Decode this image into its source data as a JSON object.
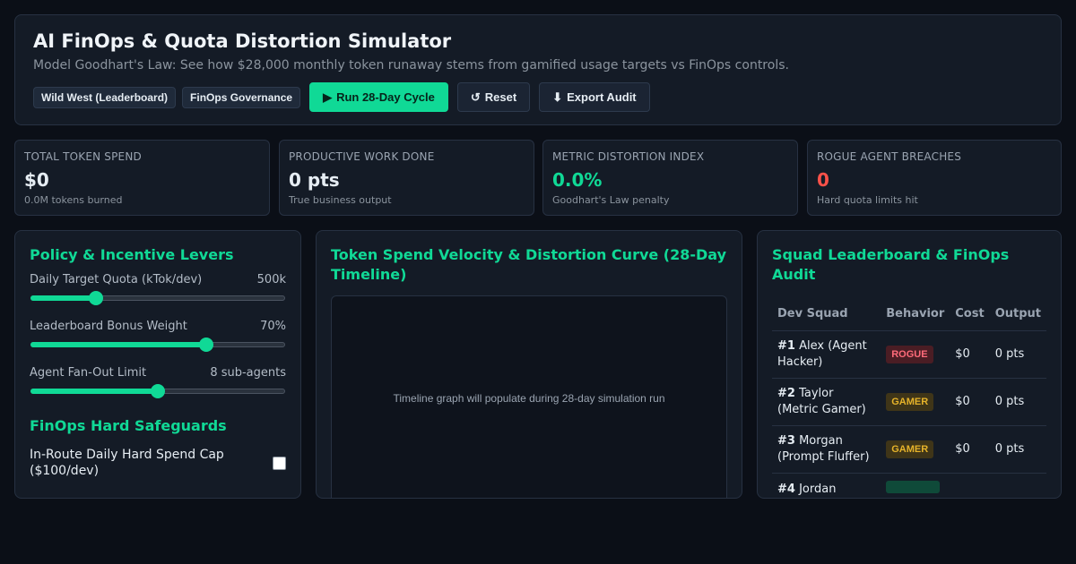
{
  "header": {
    "title": "AI FinOps & Quota Distortion Simulator",
    "subtitle": "Model Goodhart's Law: See how $28,000 monthly token runaway stems from gamified usage targets vs FinOps controls.",
    "modes": [
      "Wild West (Leaderboard)",
      "FinOps Governance"
    ],
    "run_label": "Run 28-Day Cycle",
    "reset_label": "Reset",
    "export_label": "Export Audit"
  },
  "kpis": [
    {
      "label": "TOTAL TOKEN SPEND",
      "value": "$0",
      "sub": "0.0M tokens burned"
    },
    {
      "label": "PRODUCTIVE WORK DONE",
      "value": "0 pts",
      "sub": "True business output"
    },
    {
      "label": "METRIC DISTORTION INDEX",
      "value": "0.0%",
      "sub": "Goodhart's Law penalty"
    },
    {
      "label": "ROGUE AGENT BREACHES",
      "value": "0",
      "sub": "Hard quota limits hit"
    }
  ],
  "levers": {
    "title": "Policy & Incentive Levers",
    "items": [
      {
        "label": "Daily Target Quota (kTok/dev)",
        "value": "500k",
        "level": 0.26
      },
      {
        "label": "Leaderboard Bonus Weight",
        "value": "70%",
        "level": 0.69
      },
      {
        "label": "Agent Fan-Out Limit",
        "value": "8 sub-agents",
        "level": 0.5
      }
    ],
    "safeguards_title": "FinOps Hard Safeguards",
    "safeguard_1": "In-Route Daily Hard Spend Cap ($100/dev)"
  },
  "timeline": {
    "title": "Token Spend Velocity & Distortion Curve (28-Day Timeline)",
    "placeholder": "Timeline graph will populate during 28-day simulation run"
  },
  "leaderboard": {
    "title": "Squad Leaderboard & FinOps Audit",
    "columns": [
      "Dev Squad",
      "Behavior",
      "Cost",
      "Output"
    ],
    "rows": [
      {
        "rank": "#1",
        "name": "Alex (Agent Hacker)",
        "behavior": "ROGUE",
        "cost": "$0",
        "output": "0 pts"
      },
      {
        "rank": "#2",
        "name": "Taylor (Metric Gamer)",
        "behavior": "GAMER",
        "cost": "$0",
        "output": "0 pts"
      },
      {
        "rank": "#3",
        "name": "Morgan (Prompt Fluffer)",
        "behavior": "GAMER",
        "cost": "$0",
        "output": "0 pts"
      },
      {
        "rank": "#4",
        "name": "Jordan",
        "behavior": "",
        "cost": "",
        "output": ""
      }
    ]
  }
}
